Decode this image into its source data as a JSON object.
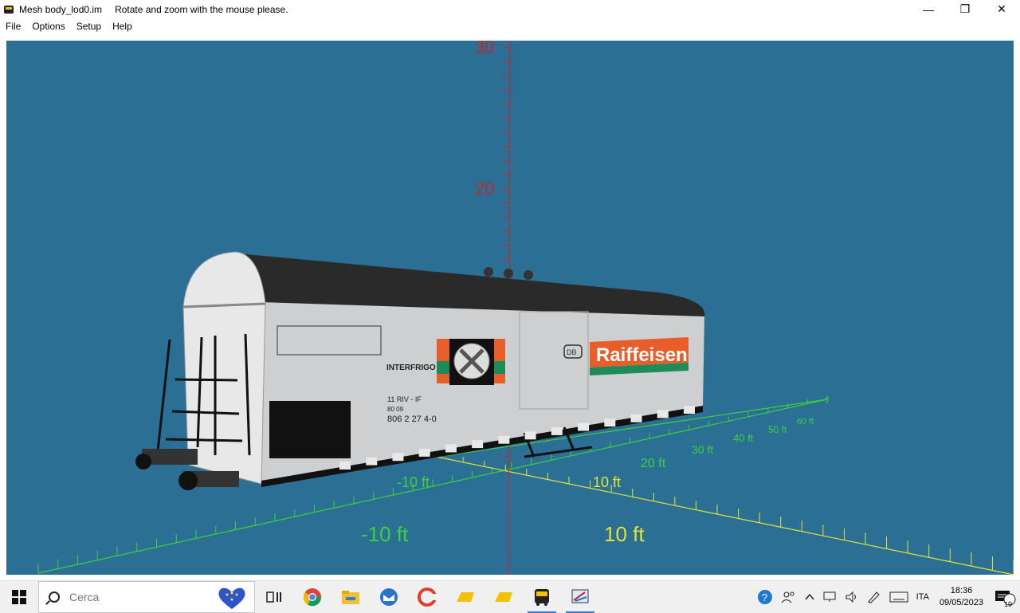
{
  "window": {
    "title": "Mesh body_lod0.im",
    "hint": "Rotate and zoom with the mouse please.",
    "controls": {
      "minimize": "—",
      "maximize": "❐",
      "close": "✕"
    }
  },
  "menu": [
    "File",
    "Options",
    "Setup",
    "Help"
  ],
  "scene": {
    "background": "#2b7094",
    "vertical_axis_labels": [
      "30",
      "20"
    ],
    "grid_labels_green": [
      "-10 ft",
      "10 ft",
      "20 ft",
      "30 ft",
      "40 ft",
      "50 ft",
      "60 ft",
      "-10 ft",
      "10 ft",
      "y"
    ],
    "axis_colors": {
      "vertical": "#c0282c",
      "green": "#39d13e",
      "yellow": "#e3e337"
    },
    "model": {
      "name": "refrigerated freight wagon",
      "livery_text": "Raiffeisen",
      "side_marking": "INTERFRIGO",
      "number": "806 2 27 4-0",
      "db_logo": "DB",
      "class_marks": [
        "11 RIV - IF",
        "80 09"
      ]
    }
  },
  "taskbar": {
    "search_placeholder": "Cerca",
    "apps": [
      "task-view",
      "chrome",
      "file-explorer",
      "thunderbird",
      "ccleaner",
      "folder-yellow-1",
      "folder-yellow-2",
      "bus-app",
      "mesh-viewer"
    ],
    "tray": {
      "language": "ITA",
      "time": "18:36",
      "date": "09/05/2023",
      "notifications": "19"
    }
  }
}
